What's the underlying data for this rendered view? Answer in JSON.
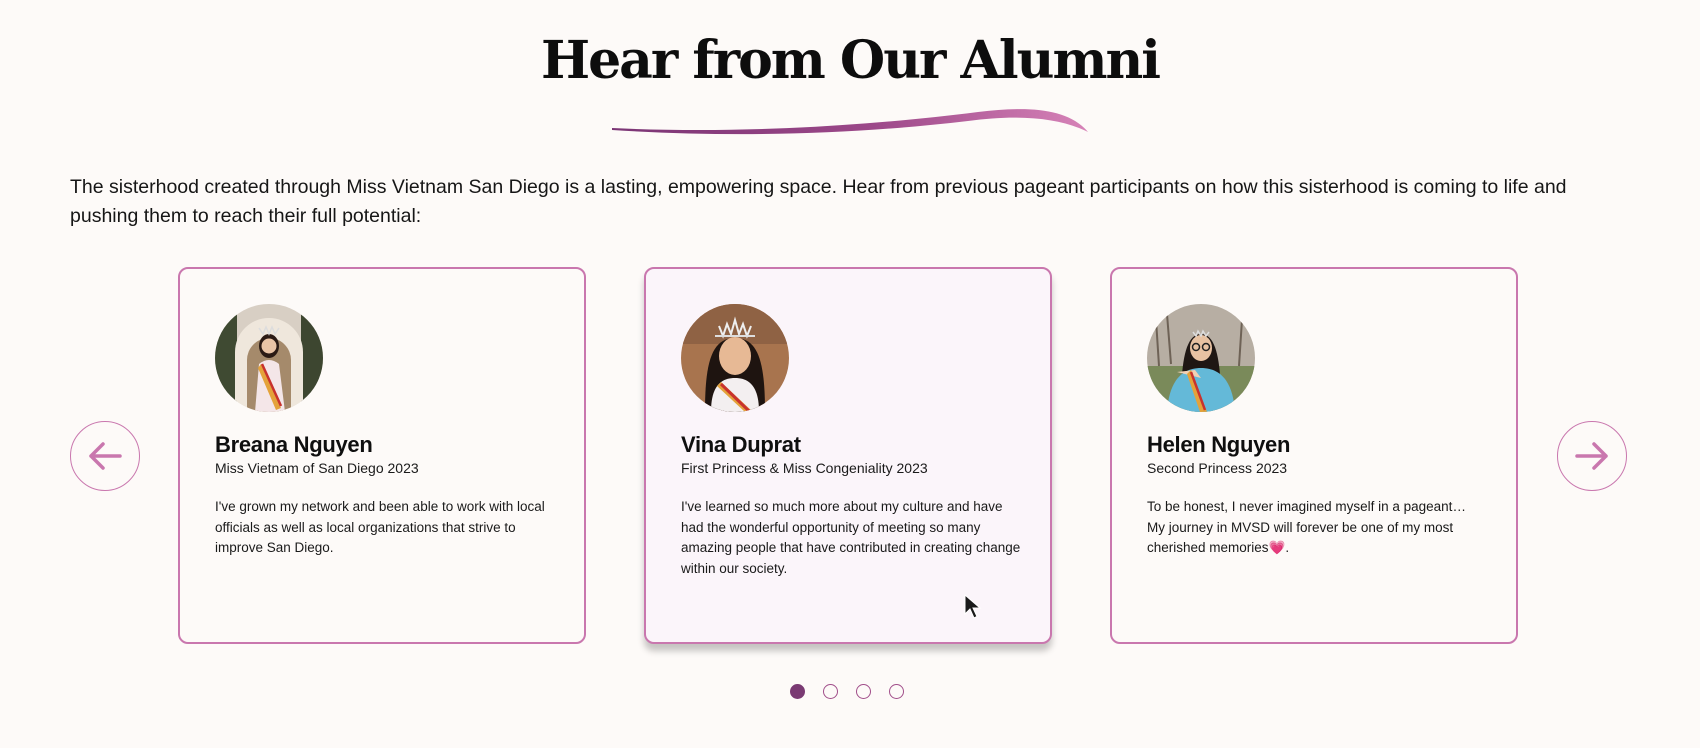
{
  "section": {
    "title": "Hear from Our Alumni",
    "intro": "The sisterhood created through Miss Vietnam San Diego is a lasting, empowering space. Hear from previous pageant participants on how this sisterhood is coming to life and pushing them to reach their full potential:"
  },
  "testimonials": [
    {
      "name": "Breana Nguyen",
      "role": "Miss Vietnam of San Diego 2023",
      "quote": "I've grown my network and been able to work with local officials as well as local organizations that strive to improve San Diego."
    },
    {
      "name": "Vina Duprat",
      "role": "First Princess & Miss Congeniality 2023",
      "quote": "I've learned so much more about my culture and have had the wonderful opportunity of meeting so many amazing people that have contributed in creating change within our society."
    },
    {
      "name": "Helen Nguyen",
      "role": "Second Princess 2023",
      "quote": "To be honest, I never imagined myself in a pageant… My journey in MVSD will forever be one of my most cherished memories💗."
    }
  ],
  "carousel": {
    "prev_icon": "arrow-left-icon",
    "next_icon": "arrow-right-icon",
    "pages": 4,
    "active_page": 1,
    "active_card": 2
  },
  "colors": {
    "accent": "#c977ae",
    "accent_dark": "#7a3a73",
    "background": "#fdfaf8",
    "active_card_bg": "#fbf5fa"
  }
}
